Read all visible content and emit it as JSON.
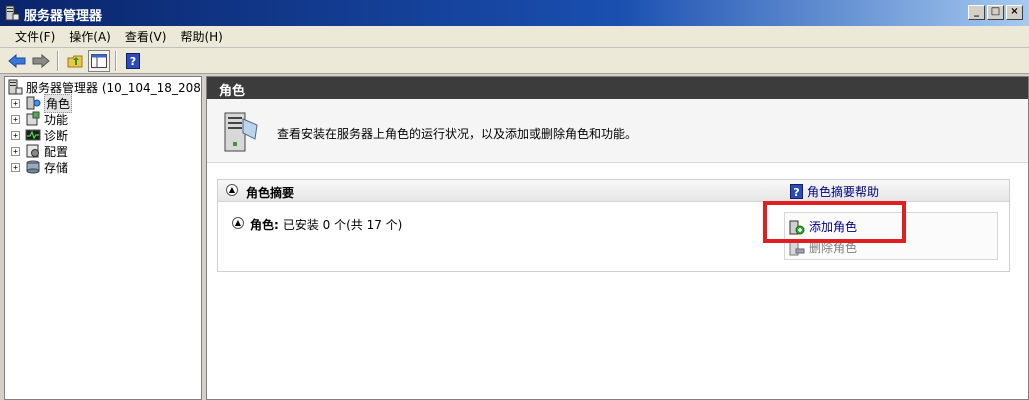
{
  "window": {
    "title": "服务器管理器"
  },
  "menu": [
    "文件(F)",
    "操作(A)",
    "查看(V)",
    "帮助(H)"
  ],
  "toolbar": {
    "icons": [
      "back-arrow-icon",
      "forward-arrow-icon",
      "up-folder-icon",
      "show-hide-tree-icon",
      "help-icon"
    ]
  },
  "tree": {
    "root_label": "服务器管理器 (10_104_18_208)",
    "items": [
      {
        "label": "角色",
        "icon": "roles-icon",
        "selected": true
      },
      {
        "label": "功能",
        "icon": "features-icon"
      },
      {
        "label": "诊断",
        "icon": "diagnostics-icon"
      },
      {
        "label": "配置",
        "icon": "configuration-icon"
      },
      {
        "label": "存储",
        "icon": "storage-icon"
      }
    ]
  },
  "main": {
    "header": "角色",
    "intro": "查看安装在服务器上角色的运行状况，以及添加或删除角色和功能。",
    "summary": {
      "title": "角色摘要",
      "help_label": "角色摘要帮助",
      "roles_label": "角色:",
      "roles_status": "已安装 0 个(共 17 个)",
      "actions": [
        {
          "label": "添加角色",
          "enabled": true
        },
        {
          "label": "删除角色",
          "enabled": false
        }
      ]
    }
  },
  "colors": {
    "header_bg": "#3c3c3c",
    "highlight_box": "#e02020",
    "link": "#000080"
  }
}
